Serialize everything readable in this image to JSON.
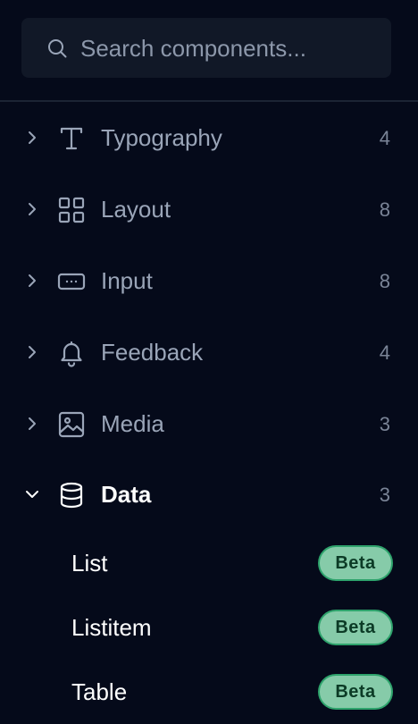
{
  "search": {
    "placeholder": "Search components..."
  },
  "categories": [
    {
      "label": "Typography",
      "count": "4",
      "icon": "type-icon",
      "expanded": false
    },
    {
      "label": "Layout",
      "count": "8",
      "icon": "grid-icon",
      "expanded": false
    },
    {
      "label": "Input",
      "count": "8",
      "icon": "input-field-icon",
      "expanded": false
    },
    {
      "label": "Feedback",
      "count": "4",
      "icon": "bell-icon",
      "expanded": false
    },
    {
      "label": "Media",
      "count": "3",
      "icon": "image-icon",
      "expanded": false
    },
    {
      "label": "Data",
      "count": "3",
      "icon": "database-icon",
      "expanded": true
    }
  ],
  "data_items": [
    {
      "label": "List",
      "badge": "Beta"
    },
    {
      "label": "Listitem",
      "badge": "Beta"
    },
    {
      "label": "Table",
      "badge": "Beta"
    }
  ],
  "colors": {
    "background": "#050a1a",
    "search_bg": "#111827",
    "muted_text": "#9aa5b8",
    "active_text": "#ffffff",
    "badge_bg": "#86cba9",
    "badge_border": "#2ea36c",
    "badge_text": "#0c3b26"
  }
}
